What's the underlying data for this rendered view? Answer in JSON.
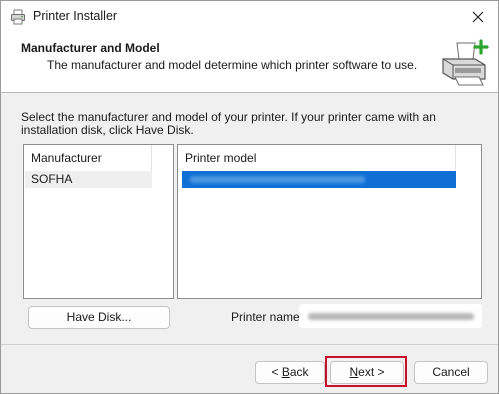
{
  "window": {
    "title": "Printer Installer"
  },
  "header": {
    "title": "Manufacturer and Model",
    "subtitle": "The manufacturer and model determine which printer software to use."
  },
  "instructions": "Select the manufacturer and model of your printer. If your printer came with an installation disk, click Have Disk.",
  "manufacturer_list": {
    "header": "Manufacturer",
    "items": [
      "SOFHA"
    ],
    "selected": "SOFHA"
  },
  "model_list": {
    "header": "Printer model",
    "items_redacted": true
  },
  "buttons": {
    "have_disk": "Have Disk...",
    "back_pre": "< ",
    "back_access": "B",
    "back_post": "ack",
    "next_access": "N",
    "next_post": "ext >",
    "cancel": "Cancel"
  },
  "printer_name": {
    "label": "Printer name:",
    "value_redacted": true
  },
  "icons": {
    "title": "printer-installer-icon",
    "close": "close-icon",
    "header_art": "printer-add-icon"
  },
  "colors": {
    "selection": "#0f6fd4",
    "highlight": "#c8102e"
  }
}
